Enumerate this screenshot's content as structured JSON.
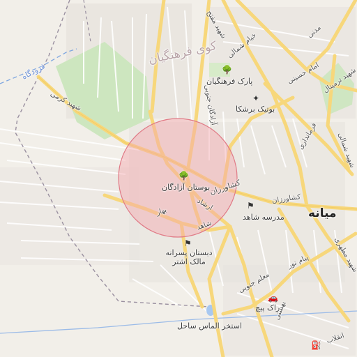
{
  "map": {
    "city": "میانه",
    "district": "کوی فرهنگیان",
    "radius_circle_color": "#f4a7ae",
    "labels": {
      "park_farhangian": "پارک فرهنگیان",
      "boutique": "بوتیک برشکا",
      "bostan_azadegan": "بوستان آزادگان",
      "madrese": "مدرسه شاهد",
      "dabestan": "دبستان پسرانه مالک اشتر",
      "rak_pich": "راک پیچ",
      "estakhr": "استخر الماس ساحل",
      "fooroodgah": "فرودگاه",
      "keshavarzan_1": "کشاورزان",
      "keshavarzan_2": "کشاورزان",
      "ershad": "ارشاد",
      "shahed": "شاهد",
      "bahar": "بهار",
      "azadegan_st": "آزادگان جنوبی",
      "shahid_karami": "شهید کرمی",
      "shahid_motahari": "شهید مطهری",
      "payam_noor_1": "پیام نور",
      "payam_noor_2": "پیام نور",
      "moalem_jonoobi": "معلم جنوبی",
      "beheshti": "بهشتی",
      "farmandari": "فرمانداری",
      "imam_hosseini": "امام حسینی",
      "terminal": "شهید ترمینال",
      "shahid_shemali": "شهید شمالی",
      "khayam_shemali": "خیام شمالی",
      "madani": "مدنی",
      "shahid_mofteh": "شهید مفتح",
      "imam": "امام",
      "shahid_jonoobi": "شهید جنوبی",
      "ostad_motahari": "استاد مطهری",
      "motahari": "مطهری",
      "enghelab": "انقلاب"
    },
    "icons": {
      "tree": "tree-icon",
      "shop": "shopping-bag-icon",
      "school": "school-icon",
      "car": "car-icon",
      "sport": "sports-icon",
      "fuel": "fuel-icon"
    }
  }
}
